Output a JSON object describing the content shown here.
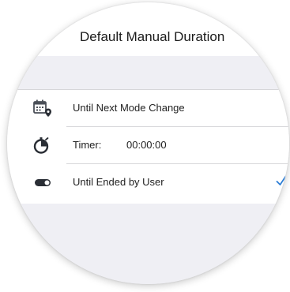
{
  "header": {
    "title": "Default Manual Duration"
  },
  "options": [
    {
      "label": "Until Next Mode Change",
      "icon": "calendar-location-icon",
      "selected": false
    },
    {
      "label": "Timer:",
      "value": "00:00:00",
      "icon": "stopwatch-icon",
      "selected": false
    },
    {
      "label": "Until Ended by User",
      "icon": "toggle-switch-icon",
      "selected": true
    }
  ],
  "colors": {
    "accent": "#2f7fd6",
    "background": "#efeff4",
    "icon": "#4a4f57"
  }
}
